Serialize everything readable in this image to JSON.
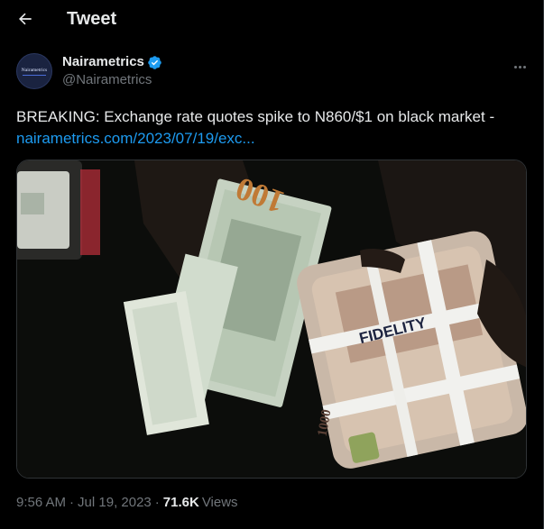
{
  "header": {
    "title": "Tweet",
    "back_icon": "arrow-left-icon"
  },
  "author": {
    "display_name": "Nairametrics",
    "handle": "@Nairametrics",
    "avatar_text": "Nairametrics",
    "verified_icon": "verified-badge-icon",
    "verified_color": "#1d9bf0",
    "more_icon": "more-horizontal-icon"
  },
  "tweet": {
    "text": "BREAKING: Exchange rate quotes spike to N860/$1 on black market -",
    "link": "nairametrics.com/2023/07/19/exc..."
  },
  "media": {
    "alt": "Hands holding bundles of US dollar and Naira banknotes",
    "usd_note_text": "100",
    "naira_note_text": "1000",
    "bank_tape_text": "FIDELITY"
  },
  "meta": {
    "time": "9:56 AM",
    "separator": "·",
    "date": "Jul 19, 2023",
    "views_count": "71.6K",
    "views_label": "Views"
  },
  "colors": {
    "background": "#000000",
    "text_primary": "#e7e9ea",
    "text_secondary": "#71767b",
    "link": "#1d9bf0",
    "border": "#2f3336"
  }
}
